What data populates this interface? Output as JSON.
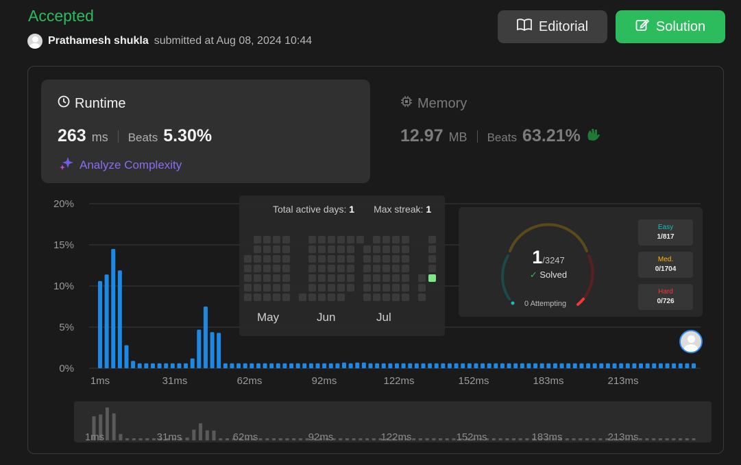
{
  "header": {
    "status": "Accepted",
    "user": "Prathamesh shukla",
    "submitted_text": "submitted at Aug 08, 2024 10:44",
    "editorial_label": "Editorial",
    "solution_label": "Solution"
  },
  "runtime": {
    "title": "Runtime",
    "value": "263",
    "unit": "ms",
    "beats_label": "Beats",
    "beats_pct": "5.30%",
    "analyze_label": "Analyze Complexity"
  },
  "memory": {
    "title": "Memory",
    "value": "12.97",
    "unit": "MB",
    "beats_label": "Beats",
    "beats_pct": "63.21%"
  },
  "calendar": {
    "active_days_label": "Total active days:",
    "active_days": "1",
    "max_streak_label": "Max streak:",
    "max_streak": "1",
    "months": [
      "May",
      "Jun",
      "Jul"
    ]
  },
  "solved": {
    "count": "1",
    "total": "/3247",
    "label": "Solved",
    "attempting": "0 Attempting",
    "easy_label": "Easy",
    "easy": "1/817",
    "medium_label": "Med.",
    "medium": "0/1704",
    "hard_label": "Hard",
    "hard": "0/726"
  },
  "colors": {
    "accent_green": "#2cbb5d",
    "bar_blue": "#1e88e5",
    "easy": "#1cbaba",
    "medium": "#ffb700",
    "hard": "#f63737"
  },
  "chart_data": {
    "type": "bar",
    "ylabel": "",
    "xlabel": "",
    "ylim": [
      0,
      20
    ],
    "y_ticks": [
      "20%",
      "15%",
      "10%",
      "5%",
      "0%"
    ],
    "x_ticks": [
      "1ms",
      "31ms",
      "62ms",
      "92ms",
      "122ms",
      "152ms",
      "183ms",
      "213ms"
    ],
    "values": [
      10.6,
      11.4,
      14.5,
      11.9,
      2.8,
      0.9,
      0.6,
      0.6,
      0.6,
      0.6,
      0.6,
      0.6,
      0.6,
      0.6,
      1.2,
      4.7,
      7.5,
      4.4,
      4.3,
      0.6,
      0.6,
      0.6,
      0.6,
      0.6,
      0.6,
      0.6,
      0.6,
      0.6,
      0.6,
      0.6,
      0.6,
      0.6,
      0.6,
      0.6,
      0.6,
      0.6,
      0.6,
      0.7,
      0.6,
      0.7,
      0.7,
      0.6,
      0.6,
      0.6,
      0.6,
      0.6,
      0.6,
      0.6,
      0.6,
      0.6,
      0.6,
      0.6,
      0.6,
      0.6,
      0.6,
      0.6,
      0.6,
      0.6,
      0.6,
      0.6,
      0.6,
      0.6,
      0.6,
      0.6,
      0.6,
      0.6,
      0.6,
      0.6,
      0.6,
      0.6,
      0.6,
      0.6,
      0.6,
      0.6,
      0.6,
      0.6,
      0.6,
      0.6,
      0.6,
      0.6,
      0.6,
      0.6,
      0.6,
      0.6,
      0.6,
      0.6,
      0.6,
      0.6,
      0.6,
      0.6,
      0.6
    ],
    "grid": true
  }
}
